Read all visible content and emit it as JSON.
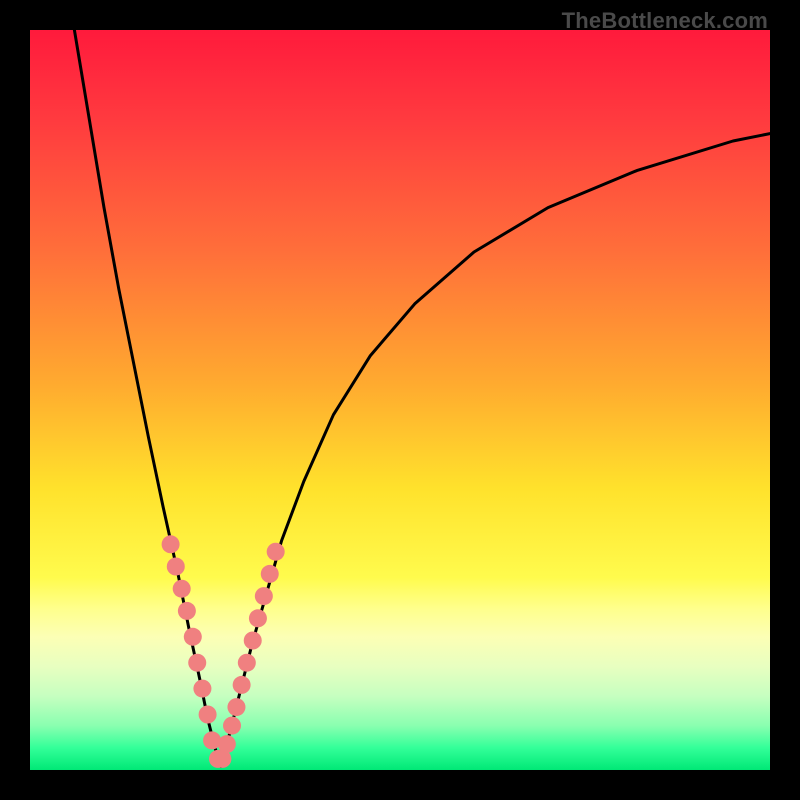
{
  "watermark": "TheBottleneck.com",
  "gradient_stops": [
    {
      "offset": 0.0,
      "color": "#ff1a3c"
    },
    {
      "offset": 0.12,
      "color": "#ff3a3f"
    },
    {
      "offset": 0.3,
      "color": "#ff6f3a"
    },
    {
      "offset": 0.48,
      "color": "#ffab2f"
    },
    {
      "offset": 0.62,
      "color": "#ffe22c"
    },
    {
      "offset": 0.74,
      "color": "#fffb4d"
    },
    {
      "offset": 0.78,
      "color": "#ffff8a"
    },
    {
      "offset": 0.82,
      "color": "#fcffb5"
    },
    {
      "offset": 0.86,
      "color": "#e8ffc0"
    },
    {
      "offset": 0.9,
      "color": "#c6ffc0"
    },
    {
      "offset": 0.94,
      "color": "#8affb0"
    },
    {
      "offset": 0.97,
      "color": "#33ff99"
    },
    {
      "offset": 1.0,
      "color": "#00e876"
    }
  ],
  "chart_data": {
    "type": "line",
    "title": "",
    "xlabel": "",
    "ylabel": "",
    "xlim": [
      0,
      100
    ],
    "ylim": [
      0,
      100
    ],
    "series": [
      {
        "name": "left-branch",
        "color": "#000000",
        "x": [
          6,
          8,
          10,
          12,
          14,
          16,
          18,
          20,
          21.5,
          23,
          24,
          25,
          25.8
        ],
        "values": [
          100,
          88,
          76,
          65,
          55,
          45,
          35.5,
          26.5,
          19,
          12,
          7,
          3,
          0.5
        ]
      },
      {
        "name": "right-branch",
        "color": "#000000",
        "x": [
          25.8,
          27,
          28.5,
          30,
          32,
          34,
          37,
          41,
          46,
          52,
          60,
          70,
          82,
          95,
          100
        ],
        "values": [
          0.5,
          5,
          11,
          17,
          24,
          31,
          39,
          48,
          56,
          63,
          70,
          76,
          81,
          85,
          86
        ]
      },
      {
        "name": "marker-dots",
        "color": "#f08080",
        "render": "scatter",
        "x": [
          19.0,
          19.7,
          20.5,
          21.2,
          22.0,
          22.6,
          23.3,
          24.0,
          24.6,
          25.4,
          26.0,
          26.6,
          27.3,
          27.9,
          28.6,
          29.3,
          30.1,
          30.8,
          31.6,
          32.4,
          33.2
        ],
        "values": [
          30.5,
          27.5,
          24.5,
          21.5,
          18.0,
          14.5,
          11.0,
          7.5,
          4.0,
          1.5,
          1.5,
          3.5,
          6.0,
          8.5,
          11.5,
          14.5,
          17.5,
          20.5,
          23.5,
          26.5,
          29.5
        ]
      }
    ],
    "annotations": []
  }
}
